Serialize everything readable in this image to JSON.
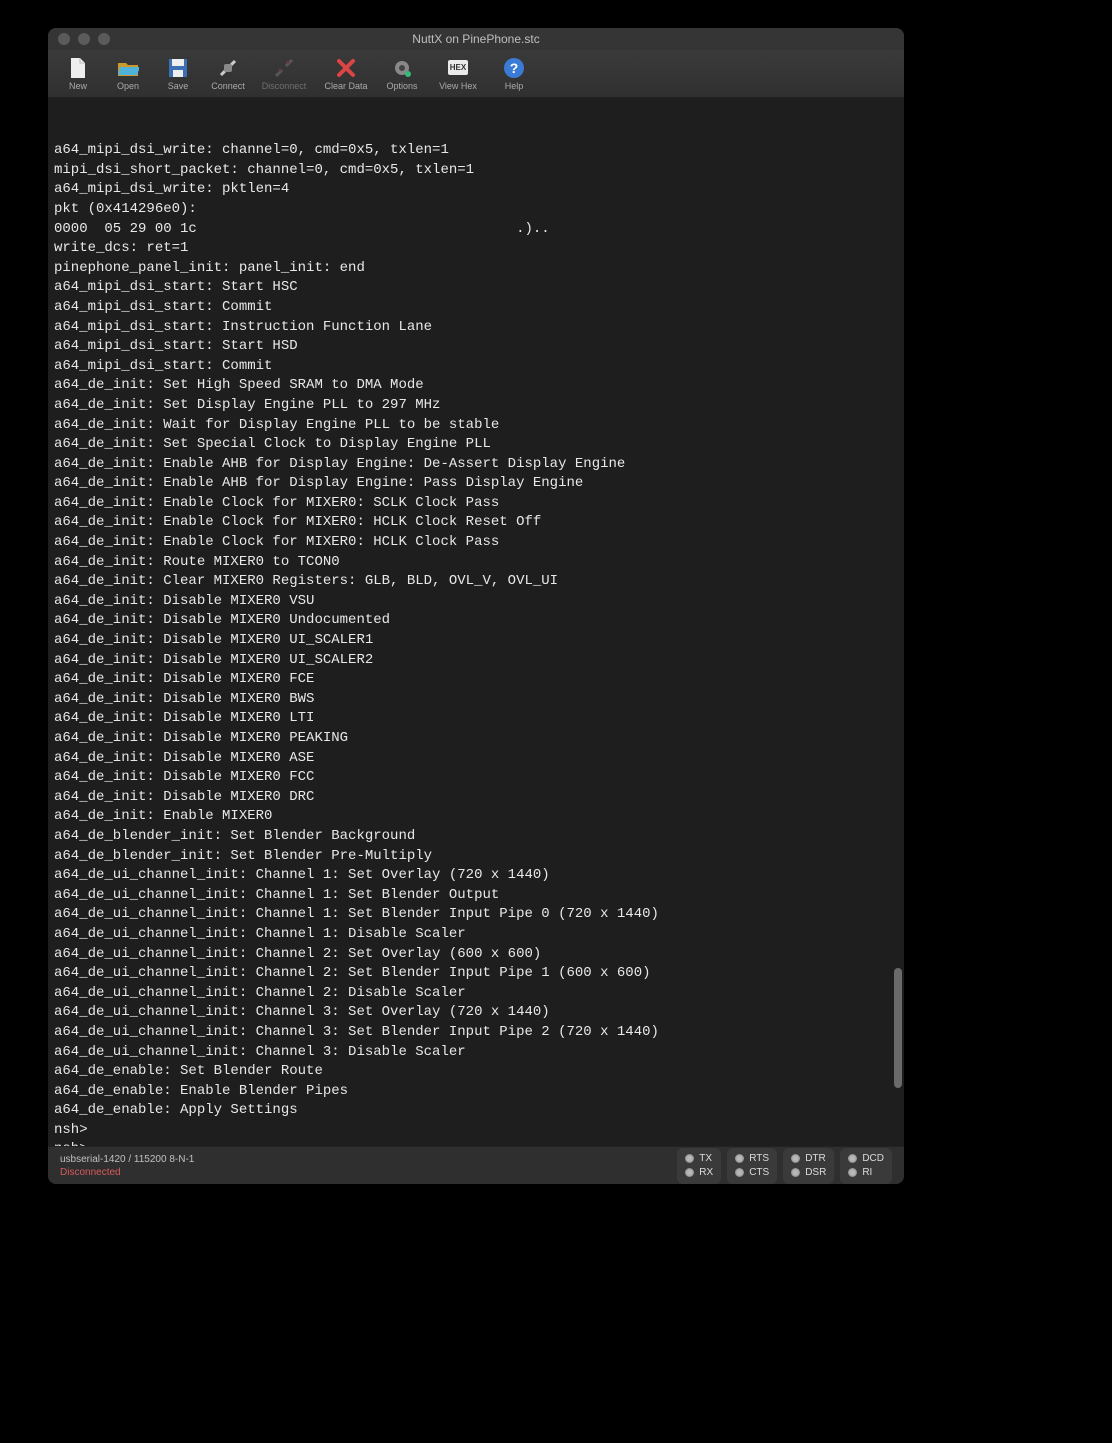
{
  "window": {
    "title": "NuttX on PinePhone.stc"
  },
  "toolbar": {
    "new": "New",
    "open": "Open",
    "save": "Save",
    "connect": "Connect",
    "disconnect": "Disconnect",
    "clear": "Clear Data",
    "options": "Options",
    "viewhex": "View Hex",
    "help": "Help"
  },
  "terminal_lines": [
    "a64_mipi_dsi_write: channel=0, cmd=0x5, txlen=1",
    "mipi_dsi_short_packet: channel=0, cmd=0x5, txlen=1",
    "a64_mipi_dsi_write: pktlen=4",
    "pkt (0x414296e0):",
    "0000  05 29 00 1c                                      .)..",
    "write_dcs: ret=1",
    "pinephone_panel_init: panel_init: end",
    "a64_mipi_dsi_start: Start HSC",
    "a64_mipi_dsi_start: Commit",
    "a64_mipi_dsi_start: Instruction Function Lane",
    "a64_mipi_dsi_start: Start HSD",
    "a64_mipi_dsi_start: Commit",
    "a64_de_init: Set High Speed SRAM to DMA Mode",
    "a64_de_init: Set Display Engine PLL to 297 MHz",
    "a64_de_init: Wait for Display Engine PLL to be stable",
    "a64_de_init: Set Special Clock to Display Engine PLL",
    "a64_de_init: Enable AHB for Display Engine: De-Assert Display Engine",
    "a64_de_init: Enable AHB for Display Engine: Pass Display Engine",
    "a64_de_init: Enable Clock for MIXER0: SCLK Clock Pass",
    "a64_de_init: Enable Clock for MIXER0: HCLK Clock Reset Off",
    "a64_de_init: Enable Clock for MIXER0: HCLK Clock Pass",
    "a64_de_init: Route MIXER0 to TCON0",
    "a64_de_init: Clear MIXER0 Registers: GLB, BLD, OVL_V, OVL_UI",
    "a64_de_init: Disable MIXER0 VSU",
    "a64_de_init: Disable MIXER0 Undocumented",
    "a64_de_init: Disable MIXER0 UI_SCALER1",
    "a64_de_init: Disable MIXER0 UI_SCALER2",
    "a64_de_init: Disable MIXER0 FCE",
    "a64_de_init: Disable MIXER0 BWS",
    "a64_de_init: Disable MIXER0 LTI",
    "a64_de_init: Disable MIXER0 PEAKING",
    "a64_de_init: Disable MIXER0 ASE",
    "a64_de_init: Disable MIXER0 FCC",
    "a64_de_init: Disable MIXER0 DRC",
    "a64_de_init: Enable MIXER0",
    "a64_de_blender_init: Set Blender Background",
    "a64_de_blender_init: Set Blender Pre-Multiply",
    "a64_de_ui_channel_init: Channel 1: Set Overlay (720 x 1440)",
    "a64_de_ui_channel_init: Channel 1: Set Blender Output",
    "a64_de_ui_channel_init: Channel 1: Set Blender Input Pipe 0 (720 x 1440)",
    "a64_de_ui_channel_init: Channel 1: Disable Scaler",
    "a64_de_ui_channel_init: Channel 2: Set Overlay (600 x 600)",
    "a64_de_ui_channel_init: Channel 2: Set Blender Input Pipe 1 (600 x 600)",
    "a64_de_ui_channel_init: Channel 2: Disable Scaler",
    "a64_de_ui_channel_init: Channel 3: Set Overlay (720 x 1440)",
    "a64_de_ui_channel_init: Channel 3: Set Blender Input Pipe 2 (720 x 1440)",
    "a64_de_ui_channel_init: Channel 3: Disable Scaler",
    "a64_de_enable: Set Blender Route",
    "a64_de_enable: Enable Blender Pipes",
    "a64_de_enable: Apply Settings",
    "nsh>",
    "nsh>"
  ],
  "status": {
    "port": "usbserial-1420 / 115200 8-N-1",
    "state": "Disconnected",
    "leds": {
      "tx": "TX",
      "rx": "RX",
      "rts": "RTS",
      "cts": "CTS",
      "dtr": "DTR",
      "dsr": "DSR",
      "dcd": "DCD",
      "ri": "RI"
    }
  }
}
